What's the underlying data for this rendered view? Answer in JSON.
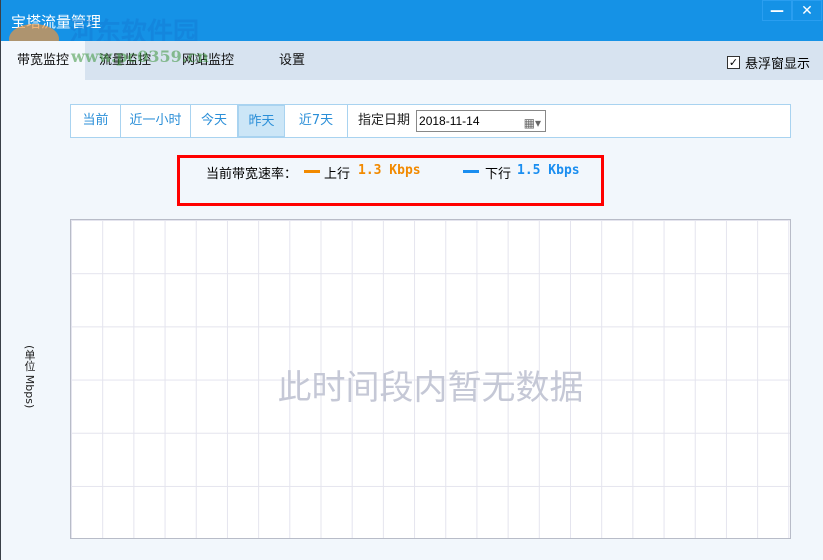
{
  "window": {
    "title": "宝塔流量管理",
    "minimize": "—",
    "close": "✕"
  },
  "tabs": [
    {
      "label": "带宽监控"
    },
    {
      "label": "流量监控"
    },
    {
      "label": "网站监控"
    },
    {
      "label": "设置"
    }
  ],
  "float_window": {
    "label": "悬浮窗显示",
    "checked": true,
    "check": "✓"
  },
  "range": {
    "buttons": [
      "当前",
      "近一小时",
      "今天",
      "昨天",
      "近7天"
    ],
    "selected": "昨天",
    "date_label": "指定日期",
    "date_value": "2018-11-14",
    "calendar_icon": "▦▾"
  },
  "rate": {
    "label": "当前带宽速率：",
    "up_label": "上行",
    "up_value": "1.3 Kbps",
    "down_label": "下行",
    "down_value": "1.5 Kbps",
    "up_color": "#f28a00",
    "down_color": "#1a8ef0"
  },
  "chart": {
    "empty_text": "此时间段内暂无数据",
    "unit_label": "(单位 Mbps)"
  },
  "watermark": {
    "text": "河东软件园",
    "url": "www.pc0359.cn"
  }
}
